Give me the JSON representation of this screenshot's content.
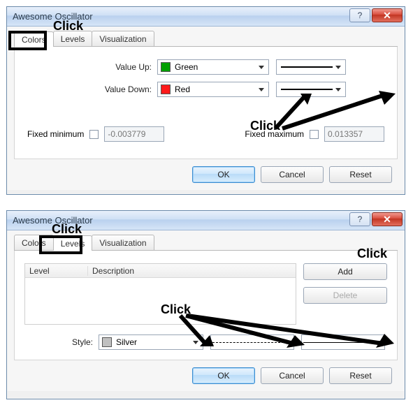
{
  "dialog1": {
    "title": "Awesome Oscillator",
    "tabs": {
      "colors": "Colors",
      "levels": "Levels",
      "visualization": "Visualization"
    },
    "valueUpLabel": "Value Up:",
    "valueUpColorName": "Green",
    "valueUpColorHex": "#00a000",
    "valueDownLabel": "Value Down:",
    "valueDownColorName": "Red",
    "valueDownColorHex": "#ff1a1a",
    "fixedMinLabel": "Fixed minimum",
    "fixedMinValue": "-0.003779",
    "fixedMaxLabel": "Fixed maximum",
    "fixedMaxValue": "0.013357",
    "ok": "OK",
    "cancel": "Cancel",
    "reset": "Reset"
  },
  "dialog2": {
    "title": "Awesome Oscillator",
    "tabs": {
      "colors": "Colors",
      "levels": "Levels",
      "visualization": "Visualization"
    },
    "table": {
      "colLevel": "Level",
      "colDesc": "Description"
    },
    "add": "Add",
    "delete": "Delete",
    "styleLabel": "Style:",
    "styleColorName": "Silver",
    "styleColorHex": "#c0c0c0",
    "ok": "OK",
    "cancel": "Cancel",
    "reset": "Reset"
  },
  "annotations": {
    "clickTop": "Click",
    "clickMid": "Click",
    "clickLevels": "Click",
    "clickAdd": "Click",
    "clickStyle": "Click"
  }
}
